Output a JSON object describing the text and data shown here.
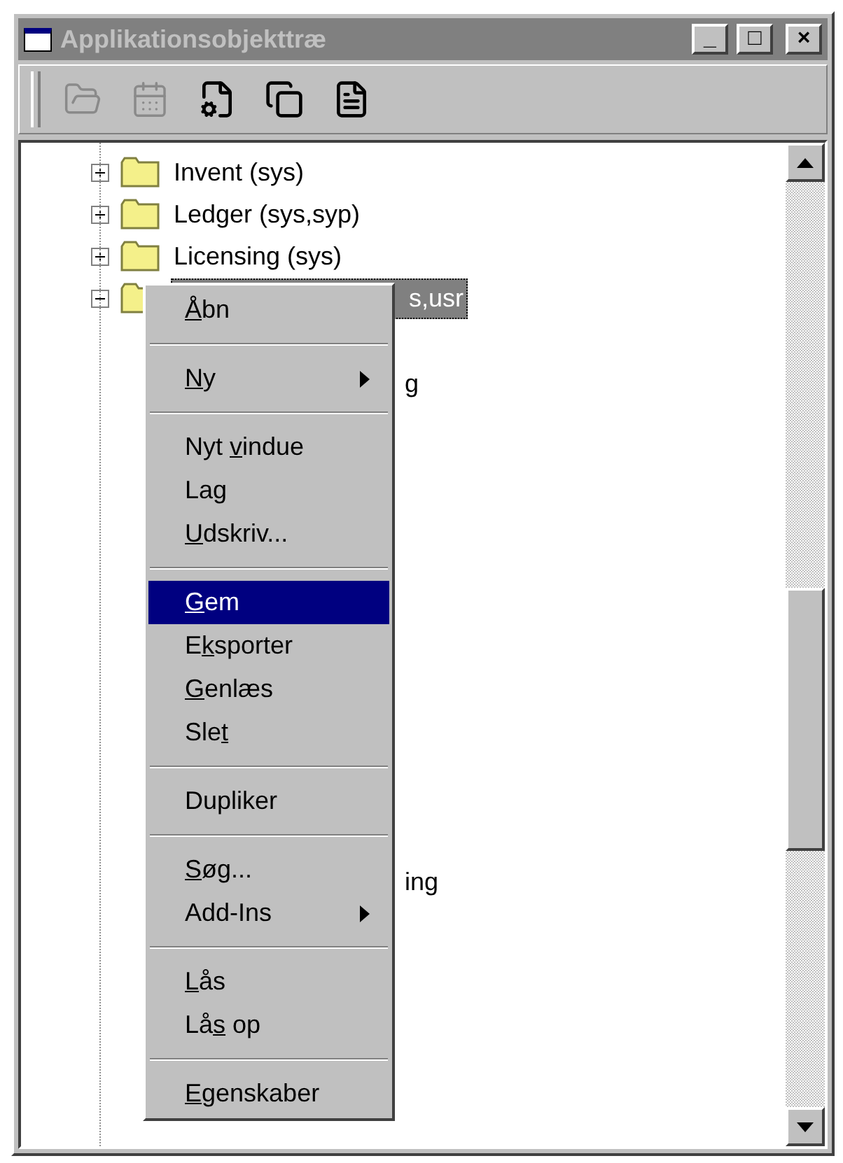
{
  "window": {
    "title": "Applikationsobjekttræ",
    "controls": [
      "_",
      "□",
      "×"
    ]
  },
  "toolbar": [
    {
      "kind": "open",
      "disabled": true
    },
    {
      "kind": "calendar",
      "disabled": true
    },
    {
      "kind": "properties",
      "disabled": false
    },
    {
      "kind": "stack",
      "disabled": false
    },
    {
      "kind": "document",
      "disabled": false
    }
  ],
  "tree": {
    "items": [
      {
        "label": "Invent (sys)",
        "expanded": false,
        "selected": false
      },
      {
        "label": "Ledger (sys,syp)",
        "expanded": false,
        "selected": false
      },
      {
        "label": "Licensing (sys)",
        "expanded": false,
        "selected": false
      },
      {
        "label": "s,usr",
        "expanded": true,
        "selected": true,
        "children": [
          {
            "label": "g"
          },
          {
            "label": "ing"
          }
        ]
      }
    ]
  },
  "context_menu": {
    "groups": [
      [
        {
          "mnemonic": "Å",
          "after": "bn",
          "submenu": false,
          "selected": false
        }
      ],
      [
        {
          "mnemonic": "N",
          "after": "y",
          "submenu": true,
          "selected": false
        }
      ],
      [
        {
          "before": "Nyt ",
          "mnemonic": "v",
          "after": "indue",
          "submenu": false,
          "selected": false
        },
        {
          "before": "Lag",
          "submenu": false,
          "selected": false
        },
        {
          "mnemonic": "U",
          "after": "dskriv...",
          "submenu": false,
          "selected": false
        }
      ],
      [
        {
          "mnemonic": "G",
          "after": "em",
          "submenu": false,
          "selected": true
        },
        {
          "before": "E",
          "mnemonic": "k",
          "after": "sporter",
          "submenu": false,
          "selected": false
        },
        {
          "mnemonic": "G",
          "after": "enlæs",
          "submenu": false,
          "selected": false
        },
        {
          "before": "Sle",
          "mnemonic": "t",
          "submenu": false,
          "selected": false
        }
      ],
      [
        {
          "before": "Dupliker",
          "submenu": false,
          "selected": false
        }
      ],
      [
        {
          "mnemonic": "S",
          "after": "øg...",
          "submenu": false,
          "selected": false
        },
        {
          "before": "Add-Ins",
          "submenu": true,
          "selected": false
        }
      ],
      [
        {
          "mnemonic": "L",
          "after": "ås",
          "submenu": false,
          "selected": false
        },
        {
          "before": "Lå",
          "mnemonic": "s",
          "after": " op",
          "submenu": false,
          "selected": false
        }
      ],
      [
        {
          "mnemonic": "E",
          "after": "genskaber",
          "submenu": false,
          "selected": false
        }
      ]
    ]
  }
}
